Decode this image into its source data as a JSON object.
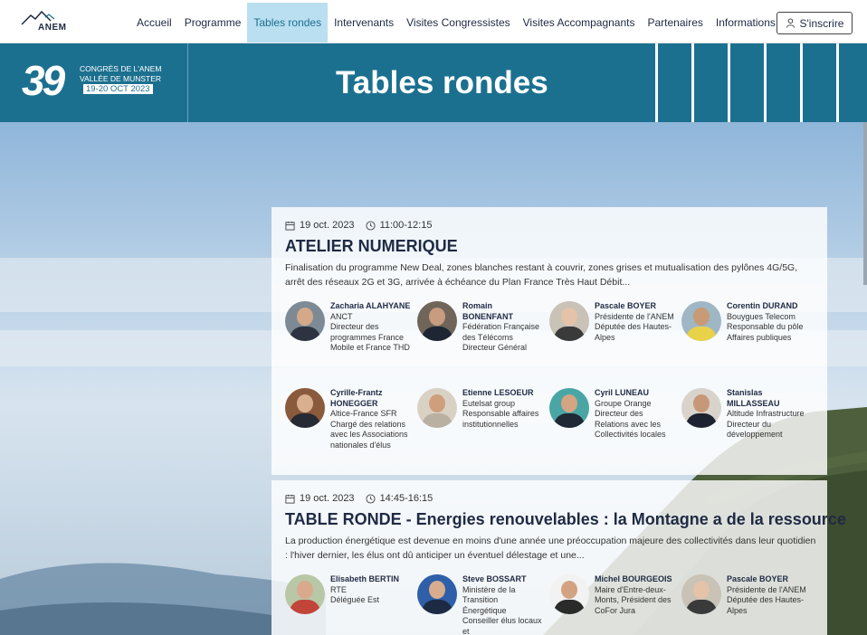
{
  "nav": {
    "logo_text": "ANEM",
    "items": [
      {
        "label": "Accueil",
        "active": false
      },
      {
        "label": "Programme",
        "active": false
      },
      {
        "label": "Tables rondes",
        "active": true
      },
      {
        "label": "Intervenants",
        "active": false
      },
      {
        "label": "Visites Congressistes",
        "active": false
      },
      {
        "label": "Visites Accompagnants",
        "active": false
      },
      {
        "label": "Partenaires",
        "active": false
      },
      {
        "label": "Informations pratiques",
        "active": false
      }
    ],
    "signup_label": "S'inscrire",
    "signup_icon": "user-icon"
  },
  "banner": {
    "badge_number": "39",
    "badge_line1": "CONGRÈS DE L'ANEM",
    "badge_line2": "VALLÉE DE MUNSTER",
    "badge_line3": "19-20 OCT 2023",
    "title": "Tables rondes",
    "color": "#1c708f"
  },
  "events": [
    {
      "date": "19 oct. 2023",
      "time": "11:00-12:15",
      "title": "ATELIER NUMERIQUE",
      "description": "Finalisation du programme New Deal, zones blanches restant à couvrir, zones grises et mutualisation des pylônes 4G/5G, arrêt des réseaux 2G et 3G, arrivée à échéance du Plan France Très Haut Débit...",
      "speakers": [
        {
          "name": "Zacharia ALAHYANE",
          "lines": [
            "ANCT",
            "Directeur des programmes France Mobile et France THD"
          ]
        },
        {
          "name": "Romain BONENFANT",
          "lines": [
            "Fédération Française des Télécoms",
            "Directeur Général"
          ]
        },
        {
          "name": "Pascale BOYER",
          "lines": [
            "Présidente de l'ANEM",
            "Députée des Hautes-Alpes"
          ]
        },
        {
          "name": "Corentin DURAND",
          "lines": [
            "Bouygues Telecom",
            "Responsable du pôle Affaires publiques"
          ]
        },
        {
          "name": "Cyrille-Frantz HONEGGER",
          "lines": [
            "Altice-France SFR",
            "Chargé des relations avec les Associations nationales d'élus"
          ]
        },
        {
          "name": "Etienne LESOEUR",
          "lines": [
            "Eutelsat group",
            "Responsable affaires institutionnelles"
          ]
        },
        {
          "name": "Cyril LUNEAU",
          "lines": [
            "Groupe Orange",
            "Directeur des Relations avec les Collectivités locales"
          ]
        },
        {
          "name": "Stanislas MILLASSEAU",
          "lines": [
            "Altitude Infrastructure",
            "Directeur du développement"
          ]
        }
      ]
    },
    {
      "date": "19 oct. 2023",
      "time": "14:45-16:15",
      "title": "TABLE RONDE - Energies renouvelables : la Montagne a de la ressource",
      "description": "La production énergétique est devenue en moins d'une année une préoccupation majeure des collectivités dans leur quotidien : l'hiver dernier, les élus ont dû anticiper un éventuel délestage et une...",
      "speakers": [
        {
          "name": "Elisabeth BERTIN",
          "lines": [
            "RTE",
            "Déléguée Est"
          ]
        },
        {
          "name": "Steve BOSSART",
          "lines": [
            "Ministère de la Transition Énergétique",
            "Conseiller élus locaux et"
          ]
        },
        {
          "name": "Michel BOURGEOIS",
          "lines": [
            "Maire d'Entre-deux-Monts, Président des CoFor Jura"
          ]
        },
        {
          "name": "Pascale BOYER",
          "lines": [
            "Présidente de l'ANEM",
            "Députée des Hautes-Alpes"
          ]
        }
      ]
    }
  ]
}
